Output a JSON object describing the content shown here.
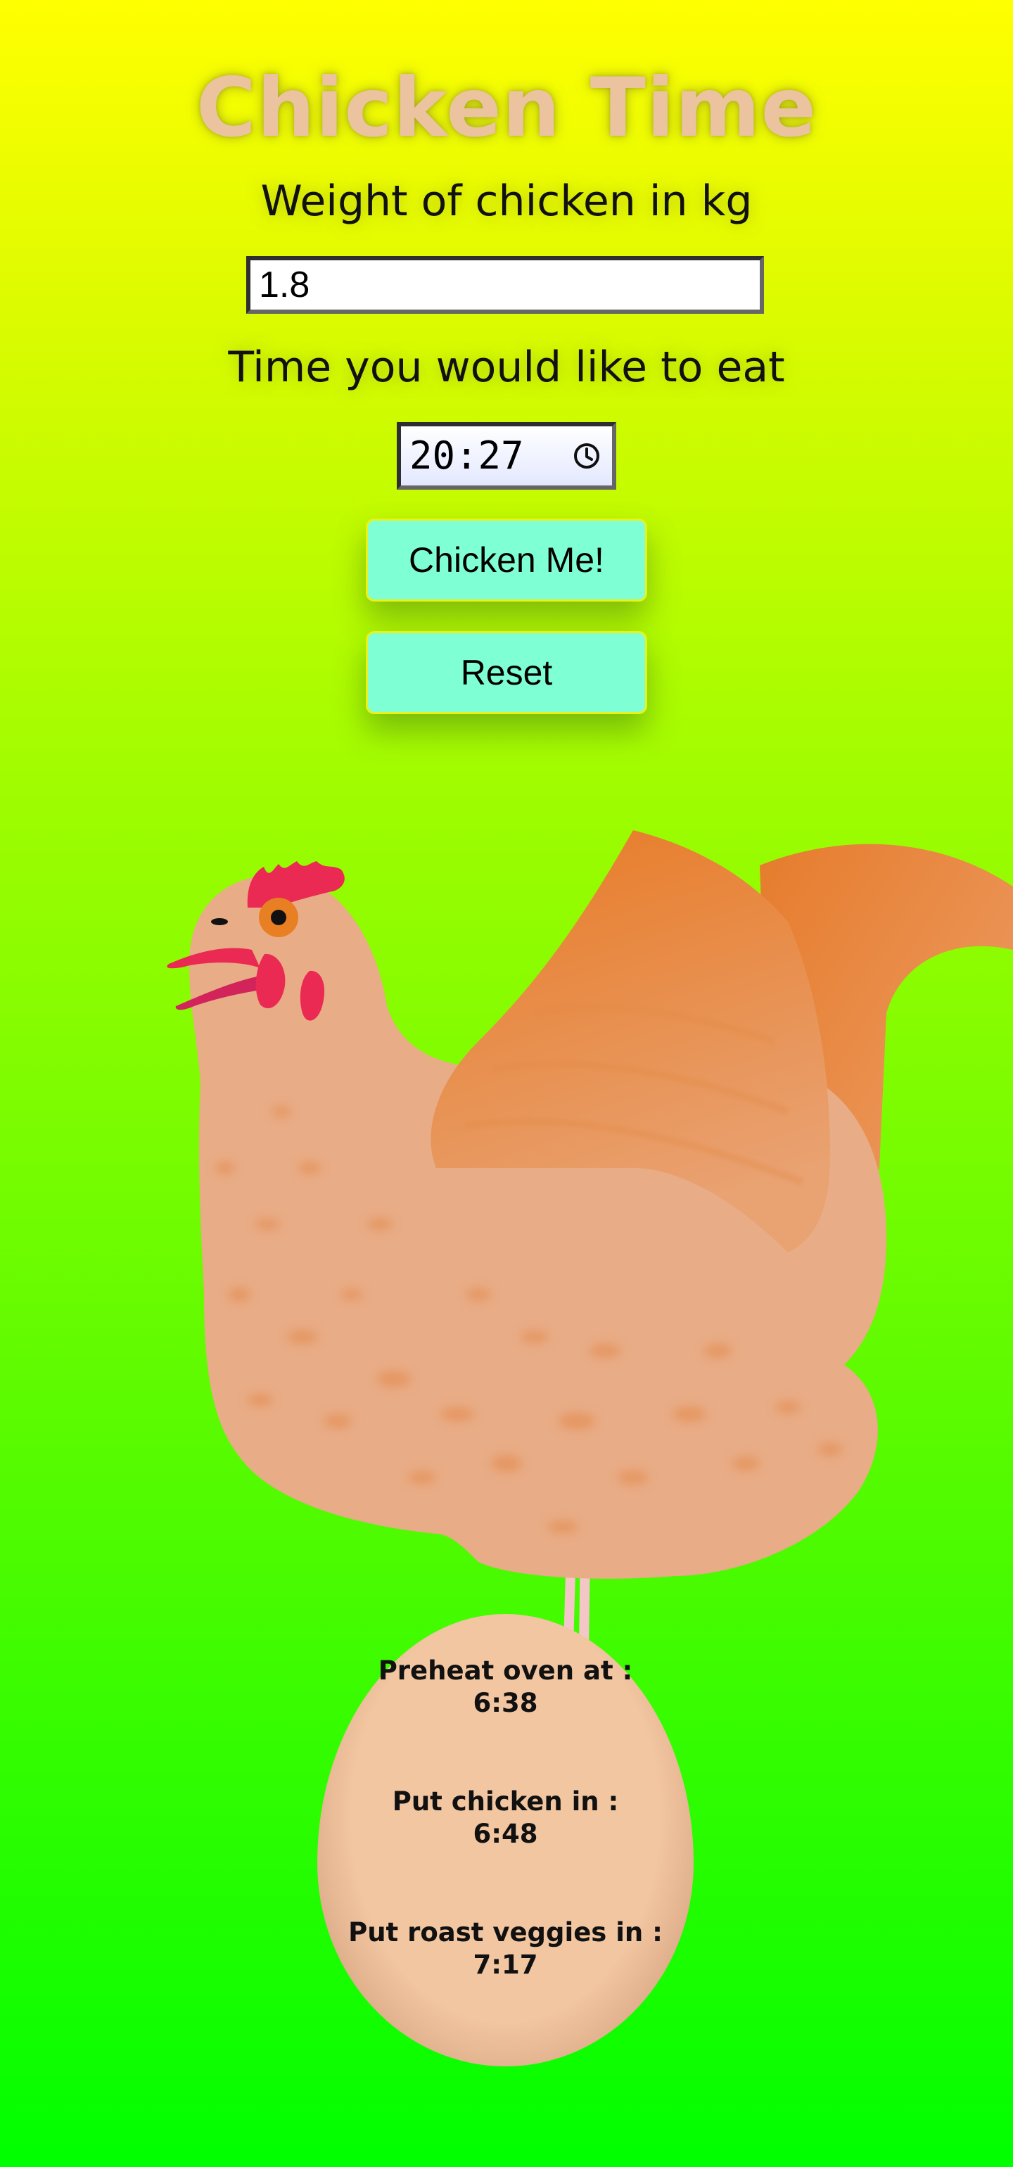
{
  "app": {
    "title": "Chicken Time"
  },
  "form": {
    "weight_label": "Weight of chicken in kg",
    "weight_value": "1.8",
    "time_label": "Time you would like to eat",
    "time_value": "20:27",
    "clock_icon": "clock-icon"
  },
  "buttons": {
    "chicken_label": "Chicken Me!",
    "reset_label": "Reset"
  },
  "results": {
    "preheat_label": "Preheat oven at :",
    "preheat_time": "6:38",
    "chicken_in_label": "Put chicken in :",
    "chicken_in_time": "6:48",
    "veggies_label": "Put roast veggies in :",
    "veggies_time": "7:17"
  },
  "colors": {
    "background_top": "#ffff00",
    "background_bottom": "#00ff00",
    "title": "#ecc39f",
    "button": "#7fffd4",
    "egg": "#f2c6a1"
  }
}
